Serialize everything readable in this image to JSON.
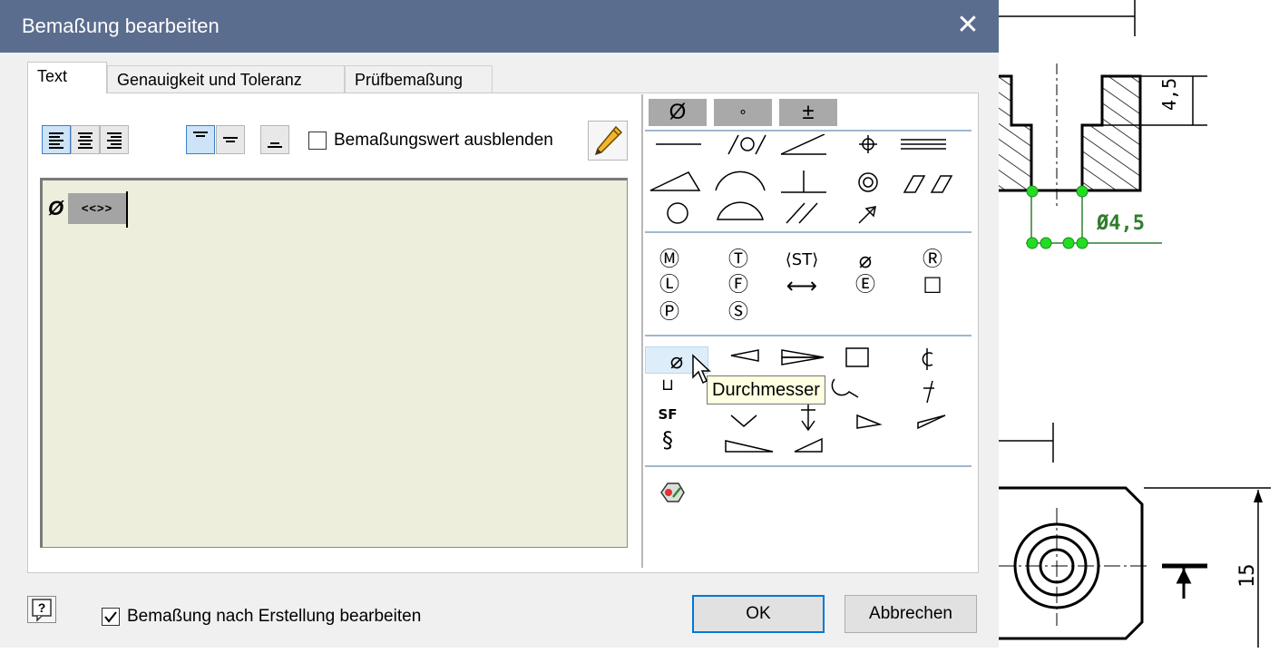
{
  "dialog": {
    "title": "Bemaßung bearbeiten",
    "close_glyph": "✕",
    "tabs": [
      {
        "label": "Text",
        "active": true
      },
      {
        "label": "Genauigkeit und Toleranz",
        "active": false
      },
      {
        "label": "Prüfbemaßung",
        "active": false
      }
    ],
    "toolbar": {
      "hide_value_label": "Bemaßungswert ausblenden",
      "hide_value_checked": false,
      "text_align": "left",
      "vertical_align": "top"
    },
    "editor": {
      "prefix_symbol": "Ø",
      "value_token": "<<>>"
    },
    "symbol_panel": {
      "header_symbols": [
        "Ø",
        "∘",
        "±"
      ],
      "tooltip": "Durchmesser",
      "hovered_symbol": "diameter"
    },
    "footer": {
      "help_glyph": "?",
      "edit_after_create_label": "Bemaßung nach Erstellung bearbeiten",
      "edit_after_create_checked": true,
      "ok_label": "OK",
      "cancel_label": "Abbrechen"
    }
  },
  "drawing": {
    "dim_top": "4,5",
    "dim_diameter": "Ø4,5",
    "dim_right": "15"
  },
  "colors": {
    "titlebar": "#5b6d8f",
    "selection": "#cde3f7",
    "editor_bg": "#eeeedd",
    "dimension_green": "#2f7d2f",
    "grip_green": "#22dd22"
  }
}
